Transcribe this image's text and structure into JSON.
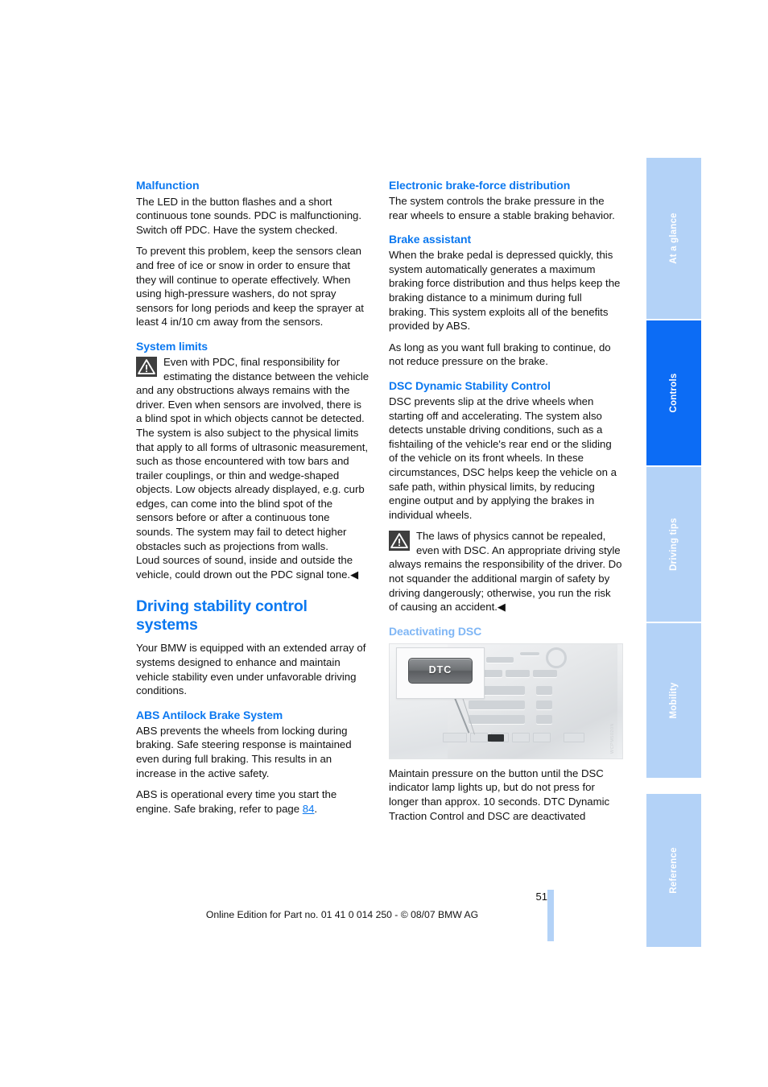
{
  "document": {
    "page_number": "51",
    "footer": "Online Edition for Part no. 01 41 0 014 250 - © 08/07 BMW AG"
  },
  "side_tabs": [
    {
      "label": "At a glance",
      "active": false
    },
    {
      "label": "Controls",
      "active": true
    },
    {
      "label": "Driving tips",
      "active": false
    },
    {
      "label": "Mobility",
      "active": false
    },
    {
      "label": "Reference",
      "active": false
    }
  ],
  "colors": {
    "heading_blue": "#0b78f0",
    "light_blue": "#7fb6f5",
    "tab_inactive": "#b3d2f7",
    "tab_active": "#0c6cf5"
  },
  "left_column": {
    "malfunction_heading": "Malfunction",
    "malfunction_p1": "The LED in the button flashes and a short continuous tone sounds. PDC is malfunctioning. Switch off PDC. Have the system checked.",
    "malfunction_p2": "To prevent this problem, keep the sensors clean and free of ice or snow in order to ensure that they will continue to operate effectively. When using high-pressure washers, do not spray sensors for long periods and keep the sprayer at least 4 in/10 cm away from the sensors.",
    "system_limits_heading": "System limits",
    "system_limits_warning": "Even with PDC, final responsibility for estimating the distance between the vehicle and any obstructions always remains with the driver. Even when sensors are involved, there is a blind spot in which objects cannot be detected. The system is also subject to the physical limits that apply to all forms of ultrasonic measurement, such as those encountered with tow bars and trailer couplings, or thin and wedge-shaped objects. Low objects already displayed, e.g. curb edges, can come into the blind spot of the sensors before or after a continuous tone sounds. The system may fail to detect higher obstacles such as projections from walls.",
    "system_limits_p2": "Loud sources of sound, inside and outside the vehicle, could drown out the PDC signal tone.",
    "system_limits_endmark": "◀",
    "driving_stability_heading": "Driving stability control systems",
    "driving_stability_p1": "Your BMW is equipped with an extended array of systems designed to enhance and maintain vehicle stability even under unfavorable driving conditions.",
    "abs_heading": "ABS Antilock Brake System",
    "abs_p1": "ABS prevents the wheels from locking during braking. Safe steering response is maintained even during full braking. This results in an increase in the active safety.",
    "abs_p2_before": "ABS is operational every time you start the engine. Safe braking, refer to page ",
    "abs_p2_link": "84",
    "abs_p2_after": "."
  },
  "right_column": {
    "ebd_heading": "Electronic brake-force distribution",
    "ebd_p1": "The system controls the brake pressure in the rear wheels to ensure a stable braking behavior.",
    "brake_assistant_heading": "Brake assistant",
    "brake_assistant_p1": "When the brake pedal is depressed quickly, this system automatically generates a maximum braking force distribution and thus helps keep the braking distance to a minimum during full braking. This system exploits all of the benefits provided by ABS.",
    "brake_assistant_p2": "As long as you want full braking to continue, do not reduce pressure on the brake.",
    "dsc_heading": "DSC Dynamic Stability Control",
    "dsc_p1": "DSC prevents slip at the drive wheels when starting off and accelerating. The system also detects unstable driving conditions, such as a fishtailing of the vehicle's rear end or the sliding of the vehicle on its front wheels. In these circumstances, DSC helps keep the vehicle on a safe path, within physical limits, by reducing engine output and by applying the brakes in individual wheels.",
    "dsc_warning": "The laws of physics cannot be repealed, even with DSC. An appropriate driving style always remains the responsibility of the driver. Do not squander the additional margin of safety by driving dangerously; otherwise, you run the risk of causing an accident.",
    "dsc_warning_endmark": "◀",
    "deactivating_heading": "Deactivating DSC",
    "figure": {
      "button_label": "DTC",
      "watermark": "WCPM5020N"
    },
    "figure_caption": "Maintain pressure on the button until the DSC indicator lamp lights up, but do not press for longer than approx. 10 seconds. DTC Dynamic Traction Control and DSC are deactivated"
  }
}
